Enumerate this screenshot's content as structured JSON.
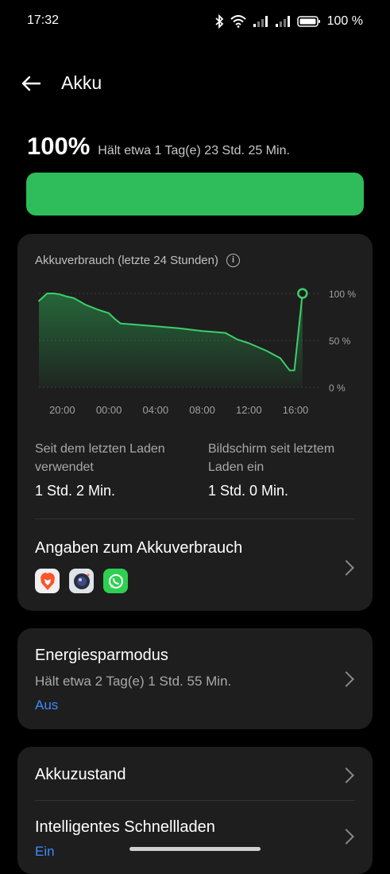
{
  "status_bar": {
    "time": "17:32",
    "battery_text": "100 %",
    "icons": [
      "bluetooth-icon",
      "wifi-icon",
      "signal-icon",
      "signal-icon",
      "battery-icon"
    ]
  },
  "header": {
    "title": "Akku",
    "back_icon": "arrow-left-icon"
  },
  "battery": {
    "level_text": "100%",
    "level_fraction": 1.0,
    "estimate": "Hält etwa 1 Tag(e) 23 Std. 25 Min.",
    "bar_color": "#2ebd5a"
  },
  "usage_card": {
    "title": "Akkuverbrauch (letzte 24 Stunden)",
    "info_icon": "info-icon",
    "since_charge_label": "Seit dem letzten Laden verwendet",
    "since_charge_value": "1 Std. 2 Min.",
    "screen_label": "Bildschirm seit letztem Laden ein",
    "screen_value": "1 Std. 0 Min.",
    "details_title": "Angaben zum Akkuverbrauch",
    "apps": [
      "brave-icon",
      "camera-icon",
      "whatsapp-icon"
    ]
  },
  "chart_data": {
    "type": "area",
    "x_tick_labels": [
      "20:00",
      "00:00",
      "04:00",
      "08:00",
      "12:00",
      "16:00"
    ],
    "y_tick_labels": [
      "100 %",
      "50 %",
      "0 %"
    ],
    "ylim": [
      0,
      100
    ],
    "xlim_hours": [
      18,
      41.7
    ],
    "x": [
      18,
      18.7,
      19.3,
      19.8,
      20.3,
      21.0,
      22.0,
      23.0,
      24.0,
      24.5,
      25.0,
      26.0,
      28.0,
      30.0,
      32.0,
      33.0,
      34.0,
      35.0,
      36.0,
      37.5,
      38.7,
      39.5,
      39.9,
      40.6
    ],
    "y": [
      92,
      100,
      100,
      99,
      97,
      95,
      88,
      83,
      79,
      73,
      68,
      67,
      65,
      63,
      60,
      59,
      58,
      51,
      47,
      39,
      31,
      18,
      18,
      100
    ],
    "line_color": "#3ccf6a",
    "grid": true,
    "end_marker": true
  },
  "power_saving": {
    "title": "Energiesparmodus",
    "subtitle": "Hält etwa 2 Tag(e) 1 Std. 55 Min.",
    "state": "Aus"
  },
  "health": {
    "title": "Akkuzustand"
  },
  "smart_charging": {
    "title": "Intelligentes Schnellladen",
    "state": "Ein"
  },
  "colors": {
    "background": "#000000",
    "card": "#1e1e1e",
    "accent_green": "#2ebd5a",
    "link_blue": "#3d8bff"
  }
}
